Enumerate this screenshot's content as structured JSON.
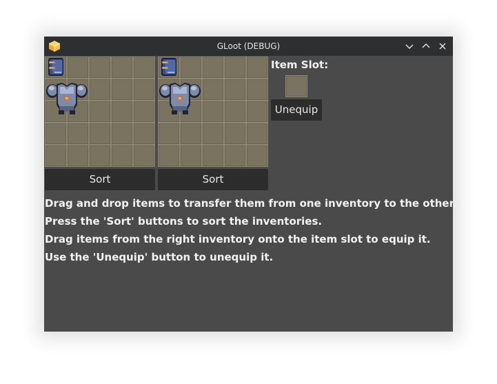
{
  "window": {
    "title": "GLoot (DEBUG)",
    "app_icon": "godot-cube-icon",
    "controls": [
      "minimize-icon",
      "maximize-icon",
      "close-icon"
    ]
  },
  "inventories": [
    {
      "name": "left",
      "sort_label": "Sort",
      "items": [
        "book",
        "armor"
      ]
    },
    {
      "name": "right",
      "sort_label": "Sort",
      "items": [
        "book",
        "armor"
      ]
    }
  ],
  "item_slot": {
    "label": "Item Slot:",
    "unequip_label": "Unequip"
  },
  "instructions": [
    "Drag and drop items to transfer them from one inventory to the other.",
    "Press the 'Sort' buttons to sort the inventories.",
    "Drag items from the right inventory onto the item slot to equip it.",
    "Use the 'Unequip' button to unequip it."
  ],
  "colors": {
    "window_bg": "#4a4a4a",
    "titlebar_bg": "#2d2f31",
    "cell_bg": "#7a735f",
    "button_bg": "#2c2c2c"
  }
}
